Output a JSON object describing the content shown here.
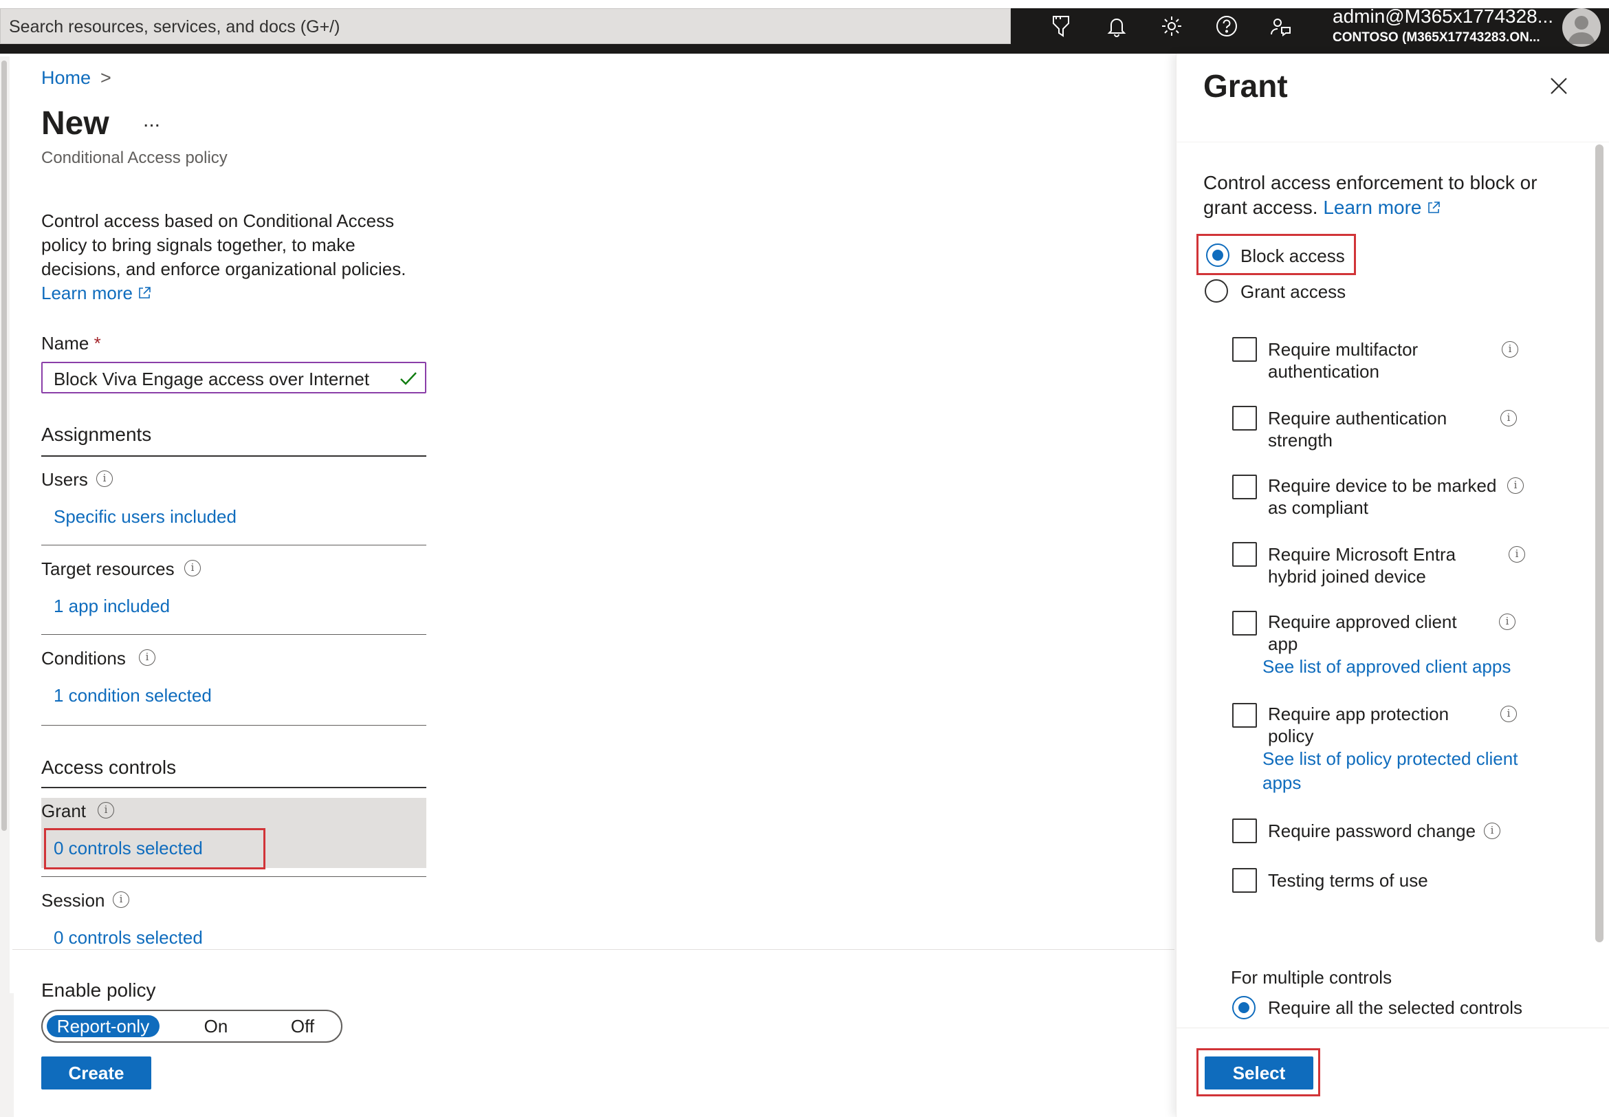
{
  "topbar": {
    "search_placeholder": "Search resources, services, and docs (G+/)",
    "account_name": "admin@M365x1774328...",
    "account_tenant": "CONTOSO (M365X17743283.ON..."
  },
  "breadcrumb": {
    "home": "Home",
    "separator": ">"
  },
  "page": {
    "title": "New",
    "more": "...",
    "subtitle": "Conditional Access policy",
    "description": "Control access based on Conditional Access policy to bring signals together, to make decisions, and enforce organizational policies.",
    "learn_more": "Learn more"
  },
  "name_field": {
    "label": "Name",
    "required": "*",
    "value": "Block Viva Engage access over Internet"
  },
  "assignments": {
    "heading": "Assignments",
    "users_label": "Users",
    "users_value": "Specific users included",
    "targets_label": "Target resources",
    "targets_value": "1 app included",
    "conditions_label": "Conditions",
    "conditions_value": "1 condition selected"
  },
  "access_controls": {
    "heading": "Access controls",
    "grant_label": "Grant",
    "grant_value": "0 controls selected",
    "session_label": "Session",
    "session_value": "0 controls selected"
  },
  "enable_policy": {
    "label": "Enable policy",
    "options": [
      "Report-only",
      "On",
      "Off"
    ],
    "selected": "Report-only"
  },
  "create_button": "Create",
  "grant_panel": {
    "title": "Grant",
    "description": "Control access enforcement to block or grant access.",
    "learn_more": "Learn more",
    "block_access": "Block access",
    "grant_access": "Grant access",
    "selected_mode": "Block access",
    "controls": [
      {
        "label": "Require multifactor authentication",
        "link": ""
      },
      {
        "label": "Require authentication strength",
        "link": ""
      },
      {
        "label": "Require device to be marked as compliant",
        "link": ""
      },
      {
        "label": "Require Microsoft Entra hybrid joined device",
        "link": ""
      },
      {
        "label": "Require approved client app",
        "link": "See list of approved client apps"
      },
      {
        "label": "Require app protection policy",
        "link": "See list of policy protected client apps"
      },
      {
        "label": "Require password change",
        "link": ""
      },
      {
        "label": "Testing terms of use",
        "link": ""
      }
    ],
    "multiple_controls_label": "For multiple controls",
    "multiple_controls_option": "Require all the selected controls",
    "select_button": "Select"
  },
  "colors": {
    "accent": "#0f6cbd",
    "highlight": "#d13438",
    "topbar": "#1b1a19"
  }
}
